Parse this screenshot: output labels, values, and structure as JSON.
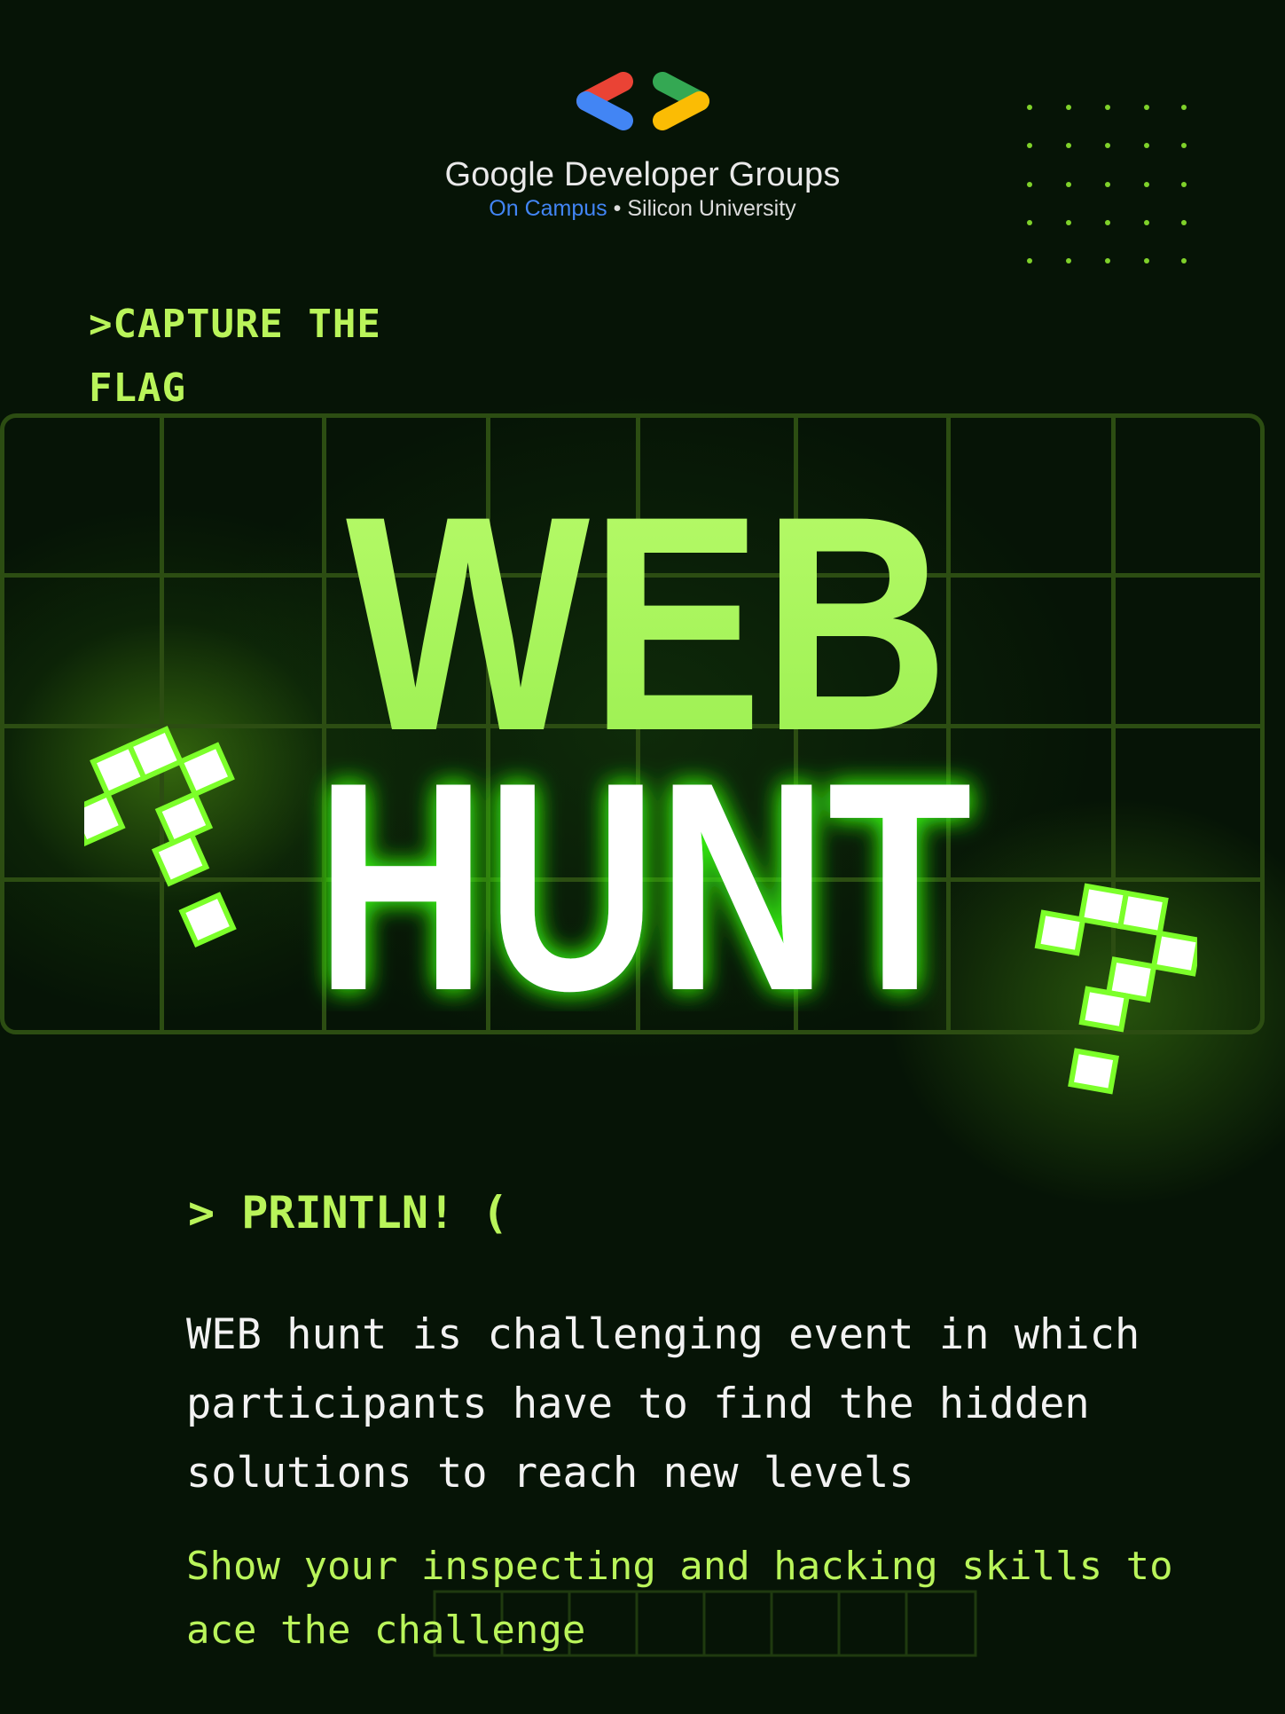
{
  "logo": {
    "title": "Google Developer Groups",
    "campus": "On Campus",
    "separator": " • ",
    "university": "Silicon University",
    "colors": {
      "red": "#ea4335",
      "blue": "#4285f4",
      "green": "#34a853",
      "yellow": "#fbbc04"
    }
  },
  "tag_line1": ">CAPTURE THE",
  "tag_line2": "FLAG",
  "headline": {
    "line1": "WEB",
    "line2": "HUNT"
  },
  "println": "> PRINTLN! (",
  "description": "WEB hunt is challenging event in which participants have to find the hidden solutions to reach new levels",
  "cta": "Show your inspecting and hacking skills to ace the challenge",
  "icons": [
    "gdg-logo-icon",
    "question-mark-icon"
  ],
  "colors": {
    "background": "#061406",
    "accent": "#b9f45a",
    "grid": "#2c4d12",
    "text": "#f2f2f2"
  }
}
